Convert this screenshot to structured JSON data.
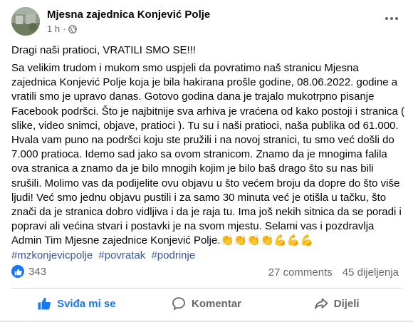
{
  "post": {
    "page_name": "Mjesna zajednica Konjević Polje",
    "time": "1 h",
    "separator": "·",
    "intro": "Dragi naši pratioci, VRATILI SMO SE!!!",
    "body": "Sa velikim trudom i mukom smo uspjeli da povratimo naš stranicu Mjesna zajednica Konjević Polje koja je bila hakirana prošle godine, 08.06.2022. godine a vratili smo je upravo danas. Gotovo godina dana je trajalo mukotrpno pisanje Facebook podršci. Što je najbitnije sva arhiva je vraćena od kako postoji i stranica ( slike, video snimci, objave, pratioci ). Tu su i naši pratioci, naša publika od 61.000. Hvala vam puno na podršci koju ste pružili i na novoj stranici, tu smo već došli do 7.000 pratioca. Idemo sad jako sa ovom stranicom. Znamo da je mnogima falila ova stranica a znamo da je bilo mnogih kojim je bilo baš drago što su nas bili srušili. Molimo vas da podijelite ovu objavu u što većem broju da dopre do što više ljudi! Već smo jednu objavu pustili i za samo 30 minuta već je otišla u tačku, što znači da je stranica dobro vidljiva i da je raja tu. Ima još nekih sitnica da se poradi i popravi ali većina stvari i postavki je na svom mjestu. Selami vas i pozdravlja Admin Tim Mjesne zajednice Konjević Polje.👏👏👏👏💪💪💪",
    "hashtags": [
      "#mzkonjevicpolje",
      "#povratak",
      "#podrinje"
    ]
  },
  "stats": {
    "reaction_count": "343",
    "comments": "27 comments",
    "shares": "45 dijeljenja"
  },
  "actions": {
    "like": "Sviđa mi se",
    "comment": "Komentar",
    "share": "Dijeli"
  },
  "colors": {
    "accent": "#1877f2",
    "hashtag": "#385898",
    "muted": "#65676b"
  },
  "icons": [
    "globe-icon",
    "more-options-icon",
    "like-icon",
    "comment-icon",
    "share-icon"
  ]
}
